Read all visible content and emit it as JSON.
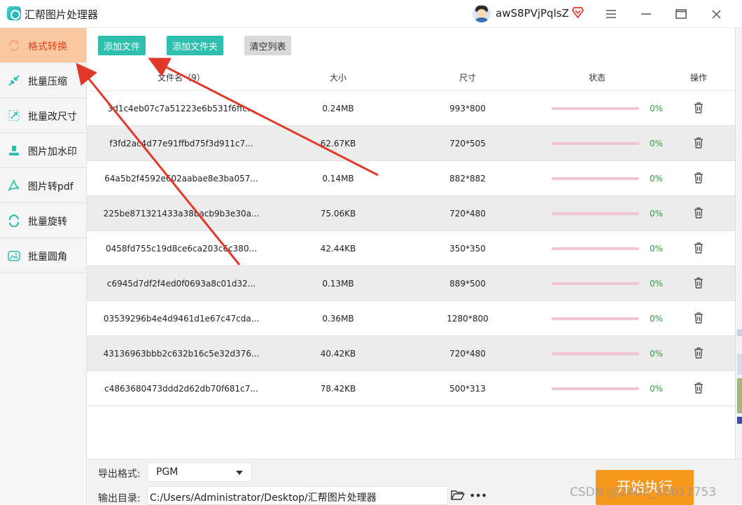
{
  "app": {
    "title": "汇帮图片处理器"
  },
  "user": {
    "name": "awS8PVjPqlsZ"
  },
  "window_controls": [
    "menu-icon",
    "minimize-icon",
    "maximize-icon",
    "close-icon"
  ],
  "sidebar": {
    "items": [
      {
        "label": "格式转换",
        "icon": "format-convert-icon",
        "active": true
      },
      {
        "label": "批量压缩",
        "icon": "compress-icon",
        "active": false
      },
      {
        "label": "批量改尺寸",
        "icon": "resize-icon",
        "active": false
      },
      {
        "label": "图片加水印",
        "icon": "watermark-icon",
        "active": false
      },
      {
        "label": "图片转pdf",
        "icon": "pdf-icon",
        "active": false
      },
      {
        "label": "批量旋转",
        "icon": "rotate-icon",
        "active": false
      },
      {
        "label": "批量圆角",
        "icon": "round-corner-icon",
        "active": false
      }
    ]
  },
  "toolbar": {
    "add_file": "添加文件",
    "add_folder": "添加文件夹",
    "clear_list": "清空列表"
  },
  "table": {
    "headers": {
      "filename": "文件名（9）",
      "size": "大小",
      "dimensions": "尺寸",
      "status": "状态",
      "actions": "操作"
    },
    "rows": [
      {
        "filename": "3d1c4eb07c7a51223e6b531f6ffc...",
        "size": "0.24MB",
        "dimensions": "993*800",
        "progress": 0,
        "status": "0%"
      },
      {
        "filename": "f3fd2ac4d77e91ffbd75f3d911c7...",
        "size": "62.67KB",
        "dimensions": "720*505",
        "progress": 0,
        "status": "0%"
      },
      {
        "filename": "64a5b2f4592e602aabae8e3ba057...",
        "size": "0.14MB",
        "dimensions": "882*882",
        "progress": 0,
        "status": "0%"
      },
      {
        "filename": "225be871321433a38bacb9b3e30a...",
        "size": "75.06KB",
        "dimensions": "720*480",
        "progress": 0,
        "status": "0%"
      },
      {
        "filename": "0458fd755c19d8ce6ca203c6c380...",
        "size": "42.44KB",
        "dimensions": "350*350",
        "progress": 0,
        "status": "0%"
      },
      {
        "filename": "c6945d7df2f4ed0f0693a8c01d32...",
        "size": "0.13MB",
        "dimensions": "889*500",
        "progress": 0,
        "status": "0%"
      },
      {
        "filename": "03539296b4e4d9461d1e67c47cda...",
        "size": "0.36MB",
        "dimensions": "1280*800",
        "progress": 0,
        "status": "0%"
      },
      {
        "filename": "43136963bbb2c632b16c5e32d376...",
        "size": "40.42KB",
        "dimensions": "720*480",
        "progress": 0,
        "status": "0%"
      },
      {
        "filename": "c4863680473ddd2d62db70f681c7...",
        "size": "78.42KB",
        "dimensions": "500*313",
        "progress": 0,
        "status": "0%"
      }
    ]
  },
  "footer": {
    "format_label": "导出格式:",
    "format_value": "PGM",
    "dir_label": "输出目录:",
    "dir_value": "C:/Users/Administrator/Desktop/汇帮图片处理器",
    "start_label": "开始执行"
  },
  "watermark": "CSDN @2403_89617753",
  "colors": {
    "accent": "#2ebfae",
    "active_tab": "#f8c8a0",
    "active_text": "#e8401c",
    "start": "#f7981d",
    "progress_ok": "#27a13a",
    "annotation_arrow": "#e0392a"
  }
}
